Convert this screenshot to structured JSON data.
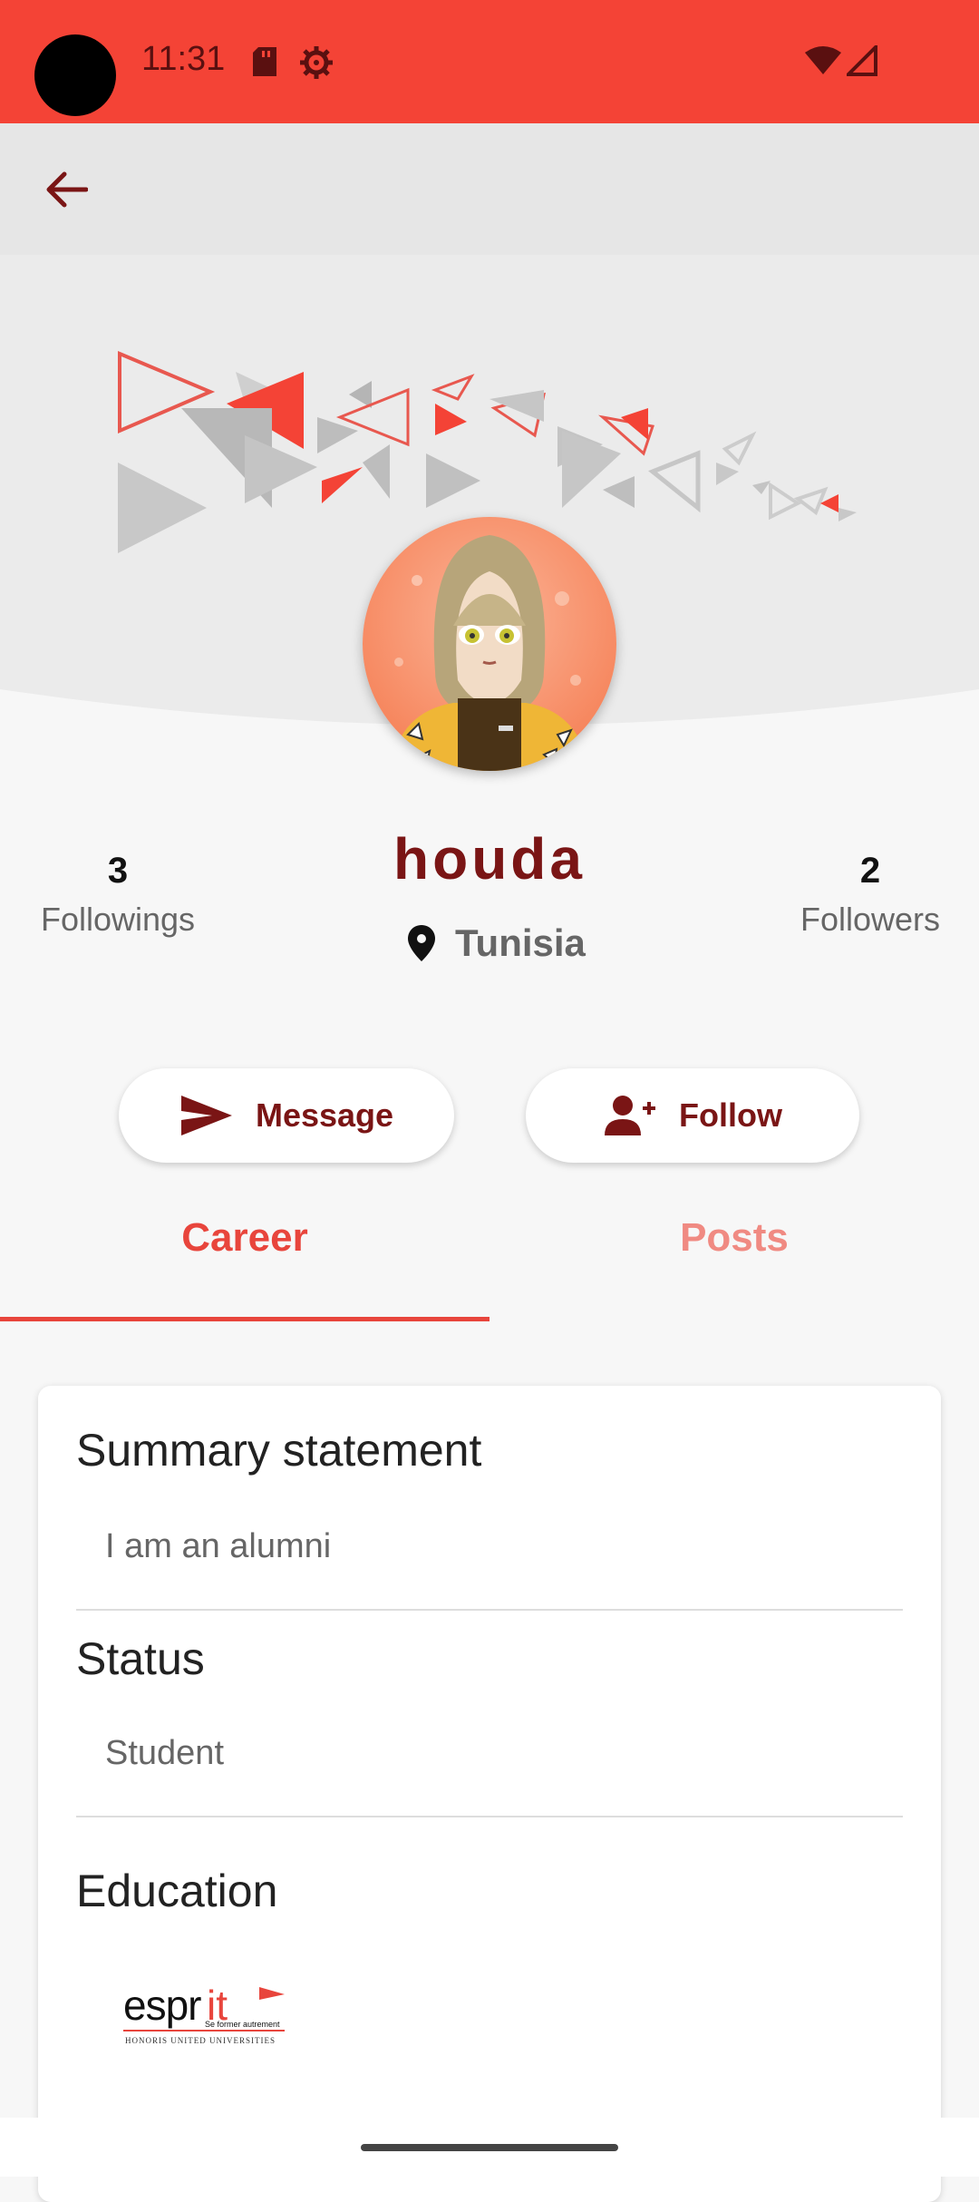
{
  "status_bar": {
    "time": "11:31"
  },
  "profile": {
    "name": "houda",
    "location": "Tunisia",
    "followings_count": "3",
    "followings_label": "Followings",
    "followers_count": "2",
    "followers_label": "Followers"
  },
  "actions": {
    "message_label": "Message",
    "follow_label": "Follow"
  },
  "tabs": [
    {
      "label": "Career",
      "selected": true
    },
    {
      "label": "Posts",
      "selected": false
    }
  ],
  "career": {
    "summary_title": "Summary statement",
    "summary_value": "I am an alumni",
    "status_title": "Status",
    "status_value": "Student",
    "education_title": "Education",
    "education_logo": "esprit",
    "education_logo_tagline": "Se former autrement",
    "education_logo_sub": "HONORIS UNITED UNIVERSITIES"
  },
  "colors": {
    "status_bar": "#f44336",
    "accent": "#e8453c",
    "primary_dark": "#7a1515"
  }
}
